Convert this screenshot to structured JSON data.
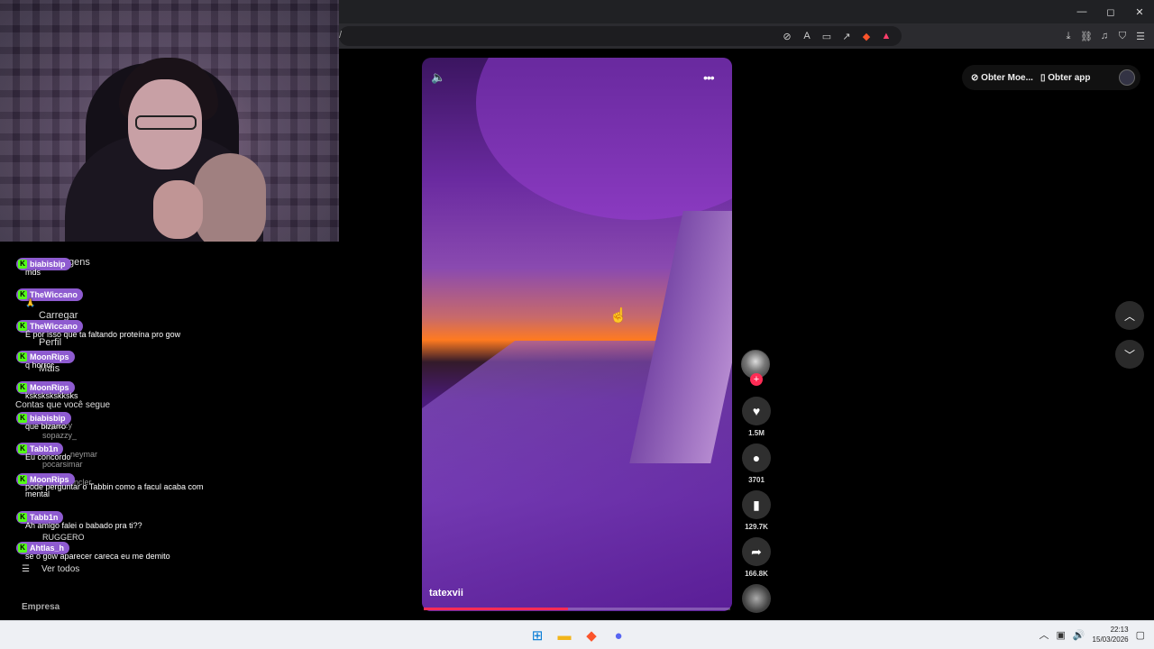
{
  "browser": {
    "address": "/",
    "window_controls": [
      "—",
      "◻",
      "✕"
    ]
  },
  "sidebar_ghost": {
    "items": [
      "gens",
      "Carregar",
      "Perfil",
      "Mais"
    ],
    "following_header": "Contas que você segue",
    "accounts": [
      "sopazzy",
      "sopazzy_",
      "neymar",
      "pocarsimar",
      "incler",
      "RUGGERO"
    ],
    "see_all": "Ver todos",
    "footer": "Empresa"
  },
  "chat": {
    "messages": [
      {
        "user": "biabisbip",
        "color": "#9a6ad8",
        "text": "mds"
      },
      {
        "user": "TheWiccano",
        "color": "#9a6ad8",
        "text": "🙏"
      },
      {
        "user": "TheWiccano",
        "color": "#9a6ad8",
        "text": "É por isso que ta faltando proteína pro gow"
      },
      {
        "user": "MoonRips",
        "color": "#9a6ad8",
        "text": "q horror"
      },
      {
        "user": "MoonRips",
        "color": "#9a6ad8",
        "text": "kskskskskksks"
      },
      {
        "user": "biabisbip",
        "color": "#9a6ad8",
        "text": "que bizarro"
      },
      {
        "user": "Tabb1n",
        "color": "#9a6ad8",
        "text": "Eu concordo"
      },
      {
        "user": "MoonRips",
        "color": "#9a6ad8",
        "text": "pode perguntar o Tabbin como a facul acaba com mental"
      },
      {
        "user": "Tabb1n",
        "color": "#9a6ad8",
        "text": "Ah amigo falei o babado pra ti??"
      },
      {
        "user": "Ahtlas_h",
        "color": "#9a6ad8",
        "text": "se o gow aparecer careca eu me demito"
      }
    ]
  },
  "video": {
    "author": "tatexvii",
    "progress": 0.47,
    "mute_icon": "🔈",
    "more_icon": "•••"
  },
  "actions": {
    "likes": "1.5M",
    "comments": "3701",
    "saves": "129.7K",
    "shares": "166.8K"
  },
  "header": {
    "coins": "Obter Moe...",
    "get_app": "Obter app"
  },
  "taskbar": {
    "time": "22:13",
    "date": "15/03/2026"
  }
}
